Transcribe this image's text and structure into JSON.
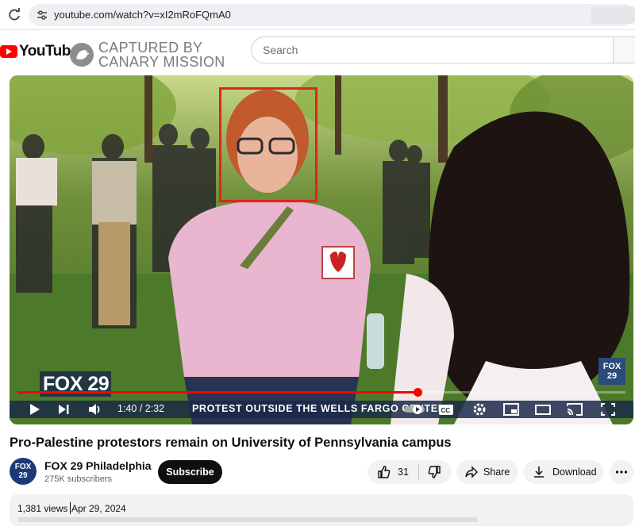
{
  "browser": {
    "url": "youtube.com/watch?v=xI2mRoFQmA0"
  },
  "header": {
    "logo_text": "YouTube",
    "watermark_line1": "CAPTURED BY",
    "watermark_line2": "CANARY MISSION",
    "search_placeholder": "Search"
  },
  "player": {
    "brand_overlay": "FOX 29",
    "corner_bug": "FOX 29",
    "ticker": "PROTEST OUTSIDE THE WELLS FARGO CENTER.",
    "time": "1:40 / 2:32",
    "progress_fraction": 0.658,
    "icons": [
      "play-icon",
      "next-icon",
      "volume-icon",
      "autoplay-toggle-icon",
      "captions-icon",
      "settings-icon",
      "miniplayer-icon",
      "theater-icon",
      "cast-icon",
      "fullscreen-icon"
    ]
  },
  "video": {
    "title": "Pro-Palestine protestors remain on University of Pennsylvania campus",
    "views": "1,381 views",
    "date": "Apr 29, 2024"
  },
  "channel": {
    "name": "FOX 29 Philadelphia",
    "subscribers": "275K subscribers",
    "avatar_text": "FOX 29",
    "subscribe_label": "Subscribe"
  },
  "actions": {
    "like_count": "31",
    "share_label": "Share",
    "download_label": "Download"
  }
}
